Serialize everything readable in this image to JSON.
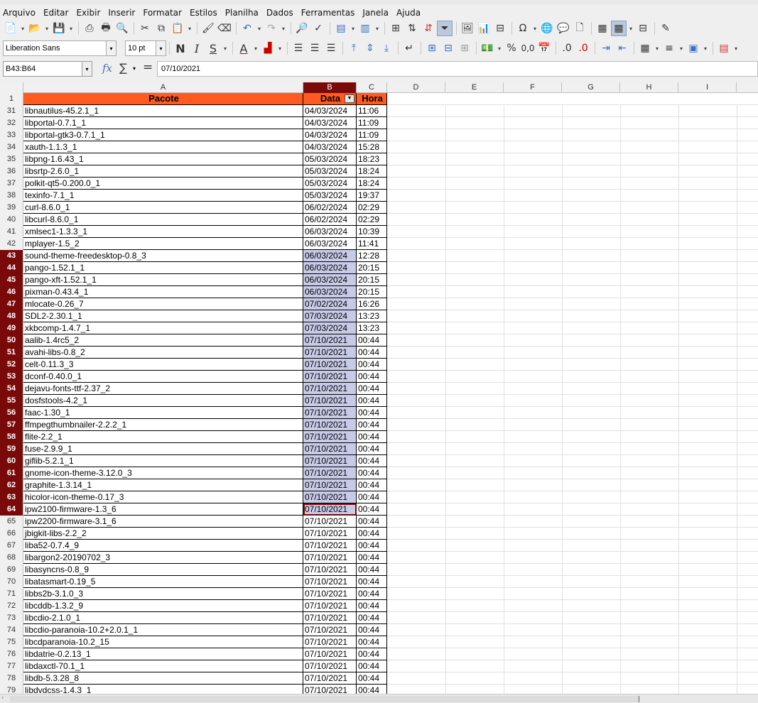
{
  "menu": [
    "Arquivo",
    "Editar",
    "Exibir",
    "Inserir",
    "Formatar",
    "Estilos",
    "Planilha",
    "Dados",
    "Ferramentas",
    "Janela",
    "Ajuda"
  ],
  "toolbar": {
    "font_name": "Liberation Sans",
    "font_size": "10 pt",
    "bold": "N",
    "italic": "I",
    "underline": "S",
    "font_color_letter": "A",
    "percent": "%",
    "decimal": "0,0"
  },
  "formula_bar": {
    "cell_ref": "B43:B64",
    "content": "07/10/2021"
  },
  "columns": [
    "A",
    "B",
    "C",
    "D",
    "E",
    "F",
    "G",
    "H",
    "I"
  ],
  "header": {
    "row_number": "1",
    "a": "Pacote",
    "b": "Data",
    "c": "Hora"
  },
  "rows": [
    {
      "n": "31",
      "a": "libnautilus-45.2.1_1",
      "b": "04/03/2024",
      "c": "11:06"
    },
    {
      "n": "32",
      "a": "libportal-0.7.1_1",
      "b": "04/03/2024",
      "c": "11:09"
    },
    {
      "n": "33",
      "a": "libportal-gtk3-0.7.1_1",
      "b": "04/03/2024",
      "c": "11:09"
    },
    {
      "n": "34",
      "a": "xauth-1.1.3_1",
      "b": "04/03/2024",
      "c": "15:28"
    },
    {
      "n": "35",
      "a": "libpng-1.6.43_1",
      "b": "05/03/2024",
      "c": "18:23"
    },
    {
      "n": "36",
      "a": "libsrtp-2.6.0_1",
      "b": "05/03/2024",
      "c": "18:24"
    },
    {
      "n": "37",
      "a": "polkit-qt5-0.200.0_1",
      "b": "05/03/2024",
      "c": "18:24"
    },
    {
      "n": "38",
      "a": "texinfo-7.1_1",
      "b": "05/03/2024",
      "c": "19:37"
    },
    {
      "n": "39",
      "a": "curl-8.6.0_1",
      "b": "06/02/2024",
      "c": "02:29"
    },
    {
      "n": "40",
      "a": "libcurl-8.6.0_1",
      "b": "06/02/2024",
      "c": "02:29"
    },
    {
      "n": "41",
      "a": "xmlsec1-1.3.3_1",
      "b": "06/03/2024",
      "c": "10:39"
    },
    {
      "n": "42",
      "a": "mplayer-1.5_2",
      "b": "06/03/2024",
      "c": "11:41"
    },
    {
      "n": "43",
      "a": "sound-theme-freedesktop-0.8_3",
      "b": "06/03/2024",
      "c": "12:28"
    },
    {
      "n": "44",
      "a": "pango-1.52.1_1",
      "b": "06/03/2024",
      "c": "20:15"
    },
    {
      "n": "45",
      "a": "pango-xft-1.52.1_1",
      "b": "06/03/2024",
      "c": "20:15"
    },
    {
      "n": "46",
      "a": "pixman-0.43.4_1",
      "b": "06/03/2024",
      "c": "20:15"
    },
    {
      "n": "47",
      "a": "mlocate-0.26_7",
      "b": "07/02/2024",
      "c": "16:26"
    },
    {
      "n": "48",
      "a": "SDL2-2.30.1_1",
      "b": "07/03/2024",
      "c": "13:23"
    },
    {
      "n": "49",
      "a": "xkbcomp-1.4.7_1",
      "b": "07/03/2024",
      "c": "13:23"
    },
    {
      "n": "50",
      "a": "aalib-1.4rc5_2",
      "b": "07/10/2021",
      "c": "00:44"
    },
    {
      "n": "51",
      "a": "avahi-libs-0.8_2",
      "b": "07/10/2021",
      "c": "00:44"
    },
    {
      "n": "52",
      "a": "celt-0.11.3_3",
      "b": "07/10/2021",
      "c": "00:44"
    },
    {
      "n": "53",
      "a": "dconf-0.40.0_1",
      "b": "07/10/2021",
      "c": "00:44"
    },
    {
      "n": "54",
      "a": "dejavu-fonts-ttf-2.37_2",
      "b": "07/10/2021",
      "c": "00:44"
    },
    {
      "n": "55",
      "a": "dosfstools-4.2_1",
      "b": "07/10/2021",
      "c": "00:44"
    },
    {
      "n": "56",
      "a": "faac-1.30_1",
      "b": "07/10/2021",
      "c": "00:44"
    },
    {
      "n": "57",
      "a": "ffmpegthumbnailer-2.2.2_1",
      "b": "07/10/2021",
      "c": "00:44"
    },
    {
      "n": "58",
      "a": "flite-2.2_1",
      "b": "07/10/2021",
      "c": "00:44"
    },
    {
      "n": "59",
      "a": "fuse-2.9.9_1",
      "b": "07/10/2021",
      "c": "00:44"
    },
    {
      "n": "60",
      "a": "giflib-5.2.1_1",
      "b": "07/10/2021",
      "c": "00:44"
    },
    {
      "n": "61",
      "a": "gnome-icon-theme-3.12.0_3",
      "b": "07/10/2021",
      "c": "00:44"
    },
    {
      "n": "62",
      "a": "graphite-1.3.14_1",
      "b": "07/10/2021",
      "c": "00:44"
    },
    {
      "n": "63",
      "a": "hicolor-icon-theme-0.17_3",
      "b": "07/10/2021",
      "c": "00:44"
    },
    {
      "n": "64",
      "a": "ipw2100-firmware-1.3_6",
      "b": "07/10/2021",
      "c": "00:44"
    },
    {
      "n": "65",
      "a": "ipw2200-firmware-3.1_6",
      "b": "07/10/2021",
      "c": "00:44"
    },
    {
      "n": "66",
      "a": "jbigkit-libs-2.2_2",
      "b": "07/10/2021",
      "c": "00:44"
    },
    {
      "n": "67",
      "a": "liba52-0.7.4_9",
      "b": "07/10/2021",
      "c": "00:44"
    },
    {
      "n": "68",
      "a": "libargon2-20190702_3",
      "b": "07/10/2021",
      "c": "00:44"
    },
    {
      "n": "69",
      "a": "libasyncns-0.8_9",
      "b": "07/10/2021",
      "c": "00:44"
    },
    {
      "n": "70",
      "a": "libatasmart-0.19_5",
      "b": "07/10/2021",
      "c": "00:44"
    },
    {
      "n": "71",
      "a": "libbs2b-3.1.0_3",
      "b": "07/10/2021",
      "c": "00:44"
    },
    {
      "n": "72",
      "a": "libcddb-1.3.2_9",
      "b": "07/10/2021",
      "c": "00:44"
    },
    {
      "n": "73",
      "a": "libcdio-2.1.0_1",
      "b": "07/10/2021",
      "c": "00:44"
    },
    {
      "n": "74",
      "a": "libcdio-paranoia-10.2+2.0.1_1",
      "b": "07/10/2021",
      "c": "00:44"
    },
    {
      "n": "75",
      "a": "libcdparanoia-10.2_15",
      "b": "07/10/2021",
      "c": "00:44"
    },
    {
      "n": "76",
      "a": "libdatrie-0.2.13_1",
      "b": "07/10/2021",
      "c": "00:44"
    },
    {
      "n": "77",
      "a": "libdaxctl-70.1_1",
      "b": "07/10/2021",
      "c": "00:44"
    },
    {
      "n": "78",
      "a": "libdb-5.3.28_8",
      "b": "07/10/2021",
      "c": "00:44"
    },
    {
      "n": "79",
      "a": "libdvdcss-1.4.3_1",
      "b": "07/10/2021",
      "c": "00:44"
    }
  ],
  "selection": {
    "first_row": "43",
    "last_row": "64",
    "cursor_row": "64"
  },
  "colors": {
    "header_fill": "#ff5a1f",
    "selection_fill": "#c8cbe8",
    "selection_header": "#7a0a0a"
  }
}
